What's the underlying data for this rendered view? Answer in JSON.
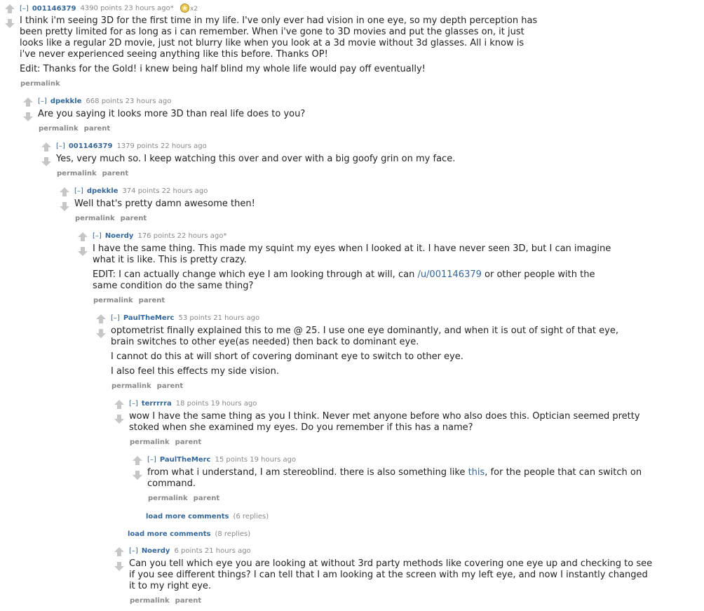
{
  "ui": {
    "toggle": "[–]",
    "permalink": "permalink",
    "parent": "parent",
    "load_more": "load more comments"
  },
  "colors": {
    "link": "#336699",
    "meta": "#888888",
    "arrow": "#c6c6c6"
  },
  "comments": [
    {
      "author": "001146379",
      "score": "4390 points 23 hours ago*",
      "gold_count": "x2",
      "lines": [
        "I think i'm seeing 3D for the first time in my life. I've only ever had vision in one eye, so my depth perception has",
        "been pretty limited for as long as i can remember. When i've gone to 3D movies and put the glasses on, it just",
        "looks like a regular 2D movie, just not blurry like when you look at a 3d movie without 3d glasses. All i know is",
        "i've never experienced seeing anything like this before. Thanks OP!",
        "Edit: Thanks for the Gold! i knew being half blind my whole life would pay off eventually!"
      ]
    },
    {
      "author": "dpekkle",
      "score": "668 points 23 hours ago",
      "lines": [
        "Are you saying it looks more 3D than real life does to you?"
      ]
    },
    {
      "author": "001146379",
      "score": "1379 points 22 hours ago",
      "lines": [
        "Yes, very much so. I keep watching this over and over with a big goofy grin on my face."
      ]
    },
    {
      "author": "dpekkle",
      "score": "374 points 22 hours ago",
      "lines": [
        "Well that's pretty damn awesome then!"
      ]
    },
    {
      "author": "Noerdy",
      "score": "176 points 22 hours ago*",
      "lines": [
        "I have the same thing. This made my squint my eyes when I looked at it. I have never seen 3D, but I can imagine",
        "what it is like. This is pretty crazy."
      ],
      "edit_before": "EDIT: I can actually change which eye I am looking through at will, can ",
      "edit_link": "/u/001146379",
      "edit_after": " or other people with the",
      "edit_line2": "same condition do the same thing?"
    },
    {
      "author": "PaulTheMerc",
      "score": "53 points 21 hours ago",
      "lines": [
        "optometrist finally explained this to me @ 25. I use one eye dominantly, and when it is out of sight of that eye,",
        "brain switches to other eye(as needed) then back to dominant eye.",
        "I cannot do this at will short of covering dominant eye to switch to other eye.",
        "I also feel this effects my side vision."
      ]
    },
    {
      "author": "terrrrra",
      "score": "18 points 19 hours ago",
      "lines": [
        "wow I have the same thing as you I think. Never met anyone before who also does this. Optician seemed pretty",
        "stoked when she examined my eyes. Do you remember if this has a name?"
      ]
    },
    {
      "author": "PaulTheMerc",
      "score": "15 points 19 hours ago",
      "line1_before": "from what i understand, I am stereoblind. there is also something like ",
      "line1_link": "this",
      "line1_after": ", for the people that can switch on",
      "line2": "command."
    },
    {
      "author": "Noerdy",
      "score": "6 points 21 hours ago",
      "lines": [
        "Can you tell which eye you are looking at without 3rd party methods like covering one eye up and checking to see",
        "if you see different things? I can tell that I am looking at the screen with my left eye, and now I instantly changed",
        "it to my right eye."
      ]
    }
  ],
  "more": [
    {
      "count": "(6 replies)"
    },
    {
      "count": "(8 replies)"
    }
  ]
}
